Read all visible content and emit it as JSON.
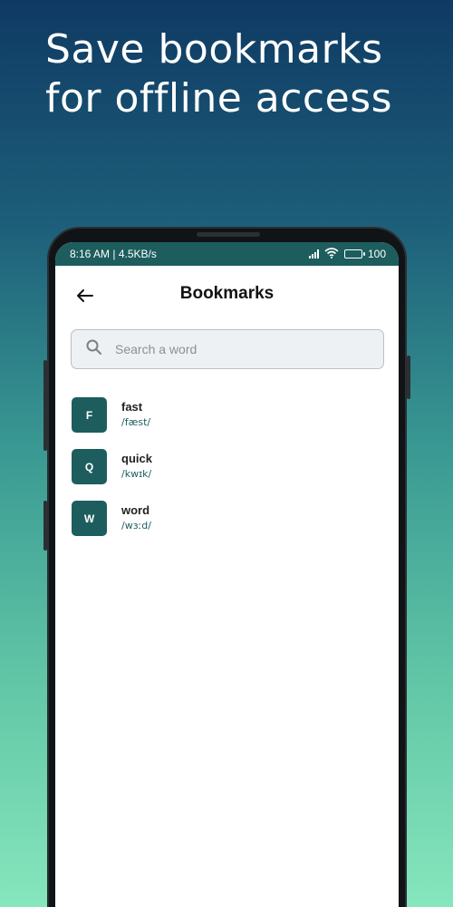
{
  "promo": {
    "headline_line1": "Save bookmarks",
    "headline_line2": "for offline access"
  },
  "status_bar": {
    "time_speed": "8:16 AM | 4.5KB/s",
    "battery": "100",
    "icons": [
      "signal-icon",
      "wifi-icon",
      "battery-icon"
    ]
  },
  "header": {
    "title": "Bookmarks",
    "back_icon": "arrow-left-icon"
  },
  "search": {
    "placeholder": "Search a word",
    "value": "",
    "icon": "search-icon"
  },
  "bookmarks": [
    {
      "letter": "F",
      "word": "fast",
      "ipa": "/fæst/"
    },
    {
      "letter": "Q",
      "word": "quick",
      "ipa": "/kwɪk/"
    },
    {
      "letter": "W",
      "word": "word",
      "ipa": "/wɜːd/"
    }
  ],
  "colors": {
    "accent": "#1d5d5e",
    "gradient_top": "#0f3a63",
    "gradient_bottom": "#86e6bd"
  }
}
